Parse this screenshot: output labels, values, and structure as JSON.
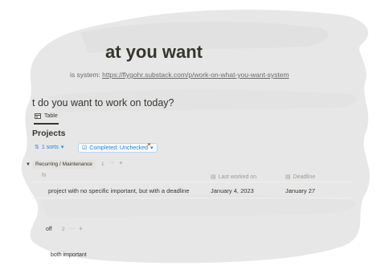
{
  "page": {
    "title_fragment": "at you want",
    "source_label": "is system:",
    "source_url": "https://flygohr.substack.com/p/work-on-what-you-want-system",
    "question": "t do you want to work on today?"
  },
  "view_tab": {
    "label": "Table",
    "icon": "table-icon"
  },
  "database": {
    "title": "Projects",
    "sorts_label": "1 sorts",
    "filter_label": "Completed: Unchecked",
    "groups": [
      {
        "label": "Recurring / Maintenance",
        "count": "1",
        "more": "···",
        "add": "+"
      },
      {
        "label": "off",
        "count": "2",
        "more": "···",
        "add": "+"
      }
    ],
    "columns": {
      "name_fragment": "N",
      "last_worked": "Last worked on",
      "deadline": "Deadline"
    },
    "rows": [
      {
        "name": "project with no specific important, but with a deadline",
        "last_worked": "January 4, 2023",
        "deadline": "January 27"
      }
    ],
    "partial_row": "both important"
  },
  "colors": {
    "accent_blue": "#2f80d6",
    "filter_dot": "#e16a28",
    "tag_gray": "#e3e2e0"
  }
}
